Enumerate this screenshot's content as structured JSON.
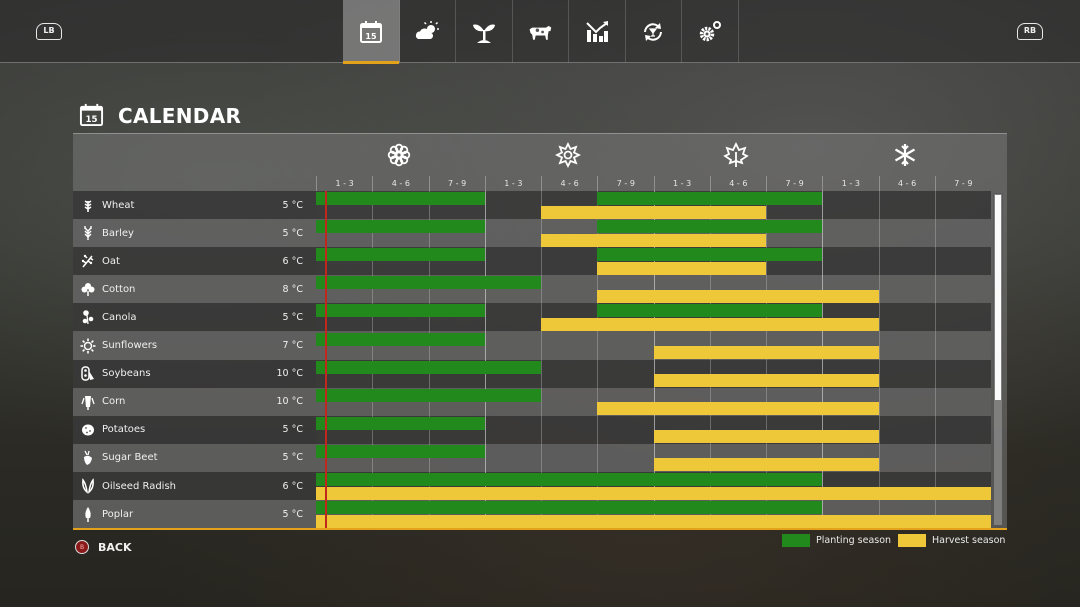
{
  "topbar": {
    "left_shoulder": "LB",
    "right_shoulder": "RB",
    "tabs": [
      {
        "id": "calendar",
        "icon": "calendar-icon",
        "label": "15",
        "active": true
      },
      {
        "id": "weather",
        "icon": "weather-icon",
        "active": false
      },
      {
        "id": "crops",
        "icon": "sprout-icon",
        "active": false
      },
      {
        "id": "animals",
        "icon": "cow-icon",
        "active": false
      },
      {
        "id": "prices",
        "icon": "chart-icon",
        "active": false
      },
      {
        "id": "contracts",
        "icon": "cycle-icon",
        "active": false
      },
      {
        "id": "settings",
        "icon": "gears-icon",
        "active": false
      }
    ]
  },
  "page": {
    "title": "CALENDAR",
    "title_icon_day": "15"
  },
  "seasons": [
    {
      "name": "spring",
      "icon": "spring-flower-icon"
    },
    {
      "name": "summer",
      "icon": "summer-sun-icon"
    },
    {
      "name": "autumn",
      "icon": "autumn-leaf-icon"
    },
    {
      "name": "winter",
      "icon": "snowflake-icon"
    }
  ],
  "periods": [
    "1 - 3",
    "4 - 6",
    "7 - 9",
    "1 - 3",
    "4 - 6",
    "7 - 9",
    "1 - 3",
    "4 - 6",
    "7 - 9",
    "1 - 3",
    "4 - 6",
    "7 - 9"
  ],
  "colors": {
    "planting": "#228a1c",
    "harvest": "#efc83a",
    "accent": "#e3a21a",
    "today_marker": "#c0281c"
  },
  "today_period_fraction": 0.16,
  "crops": [
    {
      "name": "Wheat",
      "temp": "5 °C",
      "icon": "wheat-icon",
      "planting": [
        [
          0,
          3
        ],
        [
          5,
          9
        ]
      ],
      "harvest": [
        [
          4,
          8
        ]
      ]
    },
    {
      "name": "Barley",
      "temp": "5 °C",
      "icon": "barley-icon",
      "planting": [
        [
          0,
          3
        ],
        [
          5,
          9
        ]
      ],
      "harvest": [
        [
          4,
          8
        ]
      ]
    },
    {
      "name": "Oat",
      "temp": "6 °C",
      "icon": "oat-icon",
      "planting": [
        [
          0,
          3
        ],
        [
          5,
          9
        ]
      ],
      "harvest": [
        [
          5,
          8
        ]
      ]
    },
    {
      "name": "Cotton",
      "temp": "8 °C",
      "icon": "cotton-icon",
      "planting": [
        [
          0,
          4
        ]
      ],
      "harvest": [
        [
          5,
          10
        ]
      ]
    },
    {
      "name": "Canola",
      "temp": "5 °C",
      "icon": "canola-icon",
      "planting": [
        [
          0,
          3
        ],
        [
          5,
          9
        ]
      ],
      "harvest": [
        [
          4,
          10
        ]
      ]
    },
    {
      "name": "Sunflowers",
      "temp": "7 °C",
      "icon": "sunflower-icon",
      "planting": [
        [
          0,
          3
        ]
      ],
      "harvest": [
        [
          6,
          10
        ]
      ]
    },
    {
      "name": "Soybeans",
      "temp": "10 °C",
      "icon": "soybean-icon",
      "planting": [
        [
          0,
          4
        ]
      ],
      "harvest": [
        [
          6,
          10
        ]
      ]
    },
    {
      "name": "Corn",
      "temp": "10 °C",
      "icon": "corn-icon",
      "planting": [
        [
          0,
          4
        ]
      ],
      "harvest": [
        [
          5,
          10
        ]
      ]
    },
    {
      "name": "Potatoes",
      "temp": "5 °C",
      "icon": "potato-icon",
      "planting": [
        [
          0,
          3
        ]
      ],
      "harvest": [
        [
          6,
          10
        ]
      ]
    },
    {
      "name": "Sugar Beet",
      "temp": "5 °C",
      "icon": "sugar-beet-icon",
      "planting": [
        [
          0,
          3
        ]
      ],
      "harvest": [
        [
          6,
          10
        ]
      ]
    },
    {
      "name": "Oilseed Radish",
      "temp": "6 °C",
      "icon": "radish-icon",
      "planting": [
        [
          0,
          9
        ]
      ],
      "harvest": [
        [
          0,
          12
        ]
      ]
    },
    {
      "name": "Poplar",
      "temp": "5 °C",
      "icon": "poplar-icon",
      "planting": [
        [
          0,
          9
        ]
      ],
      "harvest": [
        [
          0,
          12
        ]
      ]
    }
  ],
  "scroll": {
    "thumb_fraction": 0.62
  },
  "footer": {
    "back_button_glyph": "B",
    "back_label": "BACK",
    "legend": [
      {
        "label": "Planting season",
        "kind": "planting"
      },
      {
        "label": "Harvest season",
        "kind": "harvest"
      }
    ]
  }
}
